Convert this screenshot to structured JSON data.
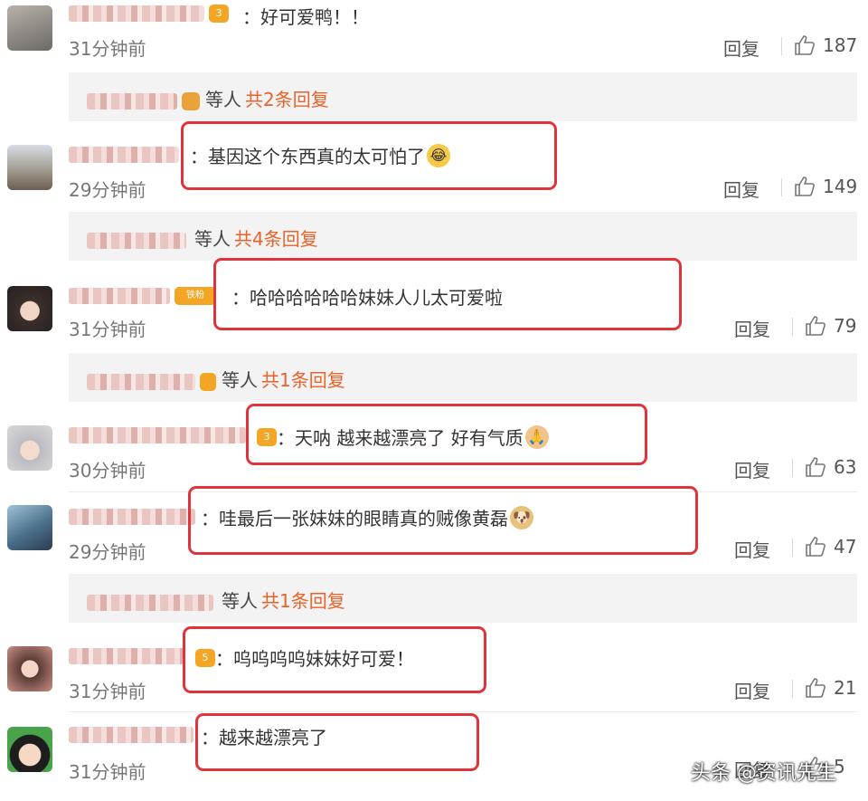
{
  "comments": [
    {
      "text": "好可爱鸭！！",
      "time": "31分钟前",
      "reply": "回复",
      "likes": "187",
      "badge": "3"
    },
    {
      "text": "基因这个东西真的太可怕了",
      "time": "29分钟前",
      "reply": "回复",
      "likes": "149"
    },
    {
      "text": "哈哈哈哈哈哈妹妹人儿太可爱啦",
      "time": "31分钟前",
      "reply": "回复",
      "likes": "79",
      "badge": "铁粉"
    },
    {
      "text": "天呐 越来越漂亮了 好有气质",
      "time": "30分钟前",
      "reply": "回复",
      "likes": "63",
      "badge": "3"
    },
    {
      "text": "哇最后一张妹妹的眼睛真的贼像黄磊",
      "time": "29分钟前",
      "reply": "回复",
      "likes": "47"
    },
    {
      "text": "呜呜呜呜妹妹好可爱！",
      "time": "31分钟前",
      "reply": "回复",
      "likes": "21",
      "badge": "5"
    },
    {
      "text": "越来越漂亮了",
      "time": "31分钟前",
      "reply": "回复",
      "likes": "5"
    }
  ],
  "threads": [
    {
      "others": "等人",
      "count": "共2条回复"
    },
    {
      "others": "等人",
      "count": "共4条回复"
    },
    {
      "others": "等人",
      "count": "共1条回复"
    },
    {
      "others": "等人",
      "count": "共1条回复"
    }
  ],
  "separator": "：",
  "watermark": "头条 @资讯先生",
  "colors": {
    "highlight": "#e0343d",
    "reply_count": "#e8622a",
    "badge": "#f3a524"
  }
}
